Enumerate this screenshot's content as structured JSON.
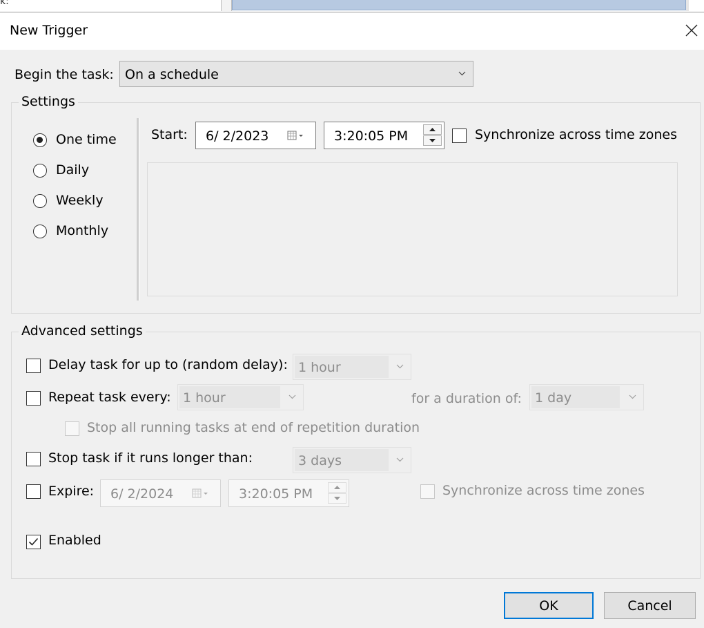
{
  "dialog": {
    "title": "New Trigger",
    "background_fragment_text": "k:"
  },
  "begin": {
    "label": "Begin the task:",
    "value": "On a schedule"
  },
  "settings": {
    "legend": "Settings",
    "schedule_options": [
      {
        "label": "One time",
        "selected": true
      },
      {
        "label": "Daily",
        "selected": false
      },
      {
        "label": "Weekly",
        "selected": false
      },
      {
        "label": "Monthly",
        "selected": false
      }
    ],
    "start": {
      "label": "Start:",
      "date": "6/  2/2023",
      "time": "3:20:05 PM",
      "sync_label": "Synchronize across time zones",
      "sync_checked": false
    }
  },
  "advanced": {
    "legend": "Advanced settings",
    "delay": {
      "label": "Delay task for up to (random delay):",
      "checked": false,
      "value": "1 hour"
    },
    "repeat": {
      "label": "Repeat task every:",
      "checked": false,
      "value": "1 hour",
      "duration_label": "for a duration of:",
      "duration_value": "1 day",
      "stop_all_label": "Stop all running tasks at end of repetition duration",
      "stop_all_checked": false
    },
    "stop_longer": {
      "label": "Stop task if it runs longer than:",
      "checked": false,
      "value": "3 days"
    },
    "expire": {
      "label": "Expire:",
      "checked": false,
      "date": "6/  2/2024",
      "time": "3:20:05 PM",
      "sync_label": "Synchronize across time zones",
      "sync_checked": false
    },
    "enabled": {
      "label": "Enabled",
      "checked": true
    }
  },
  "buttons": {
    "ok": "OK",
    "cancel": "Cancel"
  },
  "colors": {
    "dialog_bg": "#f0f0f0",
    "accent": "#0078d7",
    "disabled_text": "#8c8c8c"
  }
}
